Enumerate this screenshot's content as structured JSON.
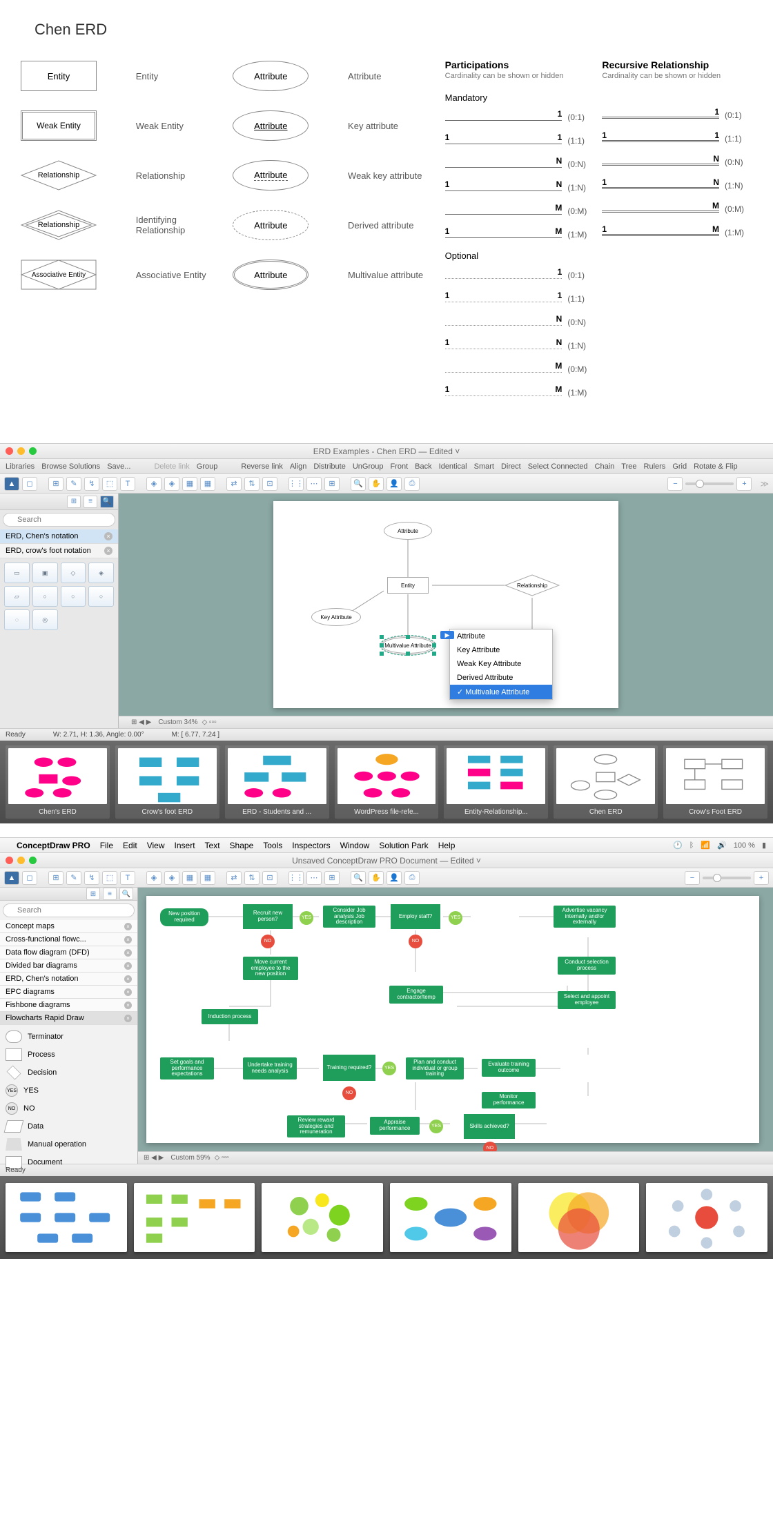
{
  "ref": {
    "title": "Chen ERD",
    "shapes_col1": [
      {
        "shape": "rect",
        "text": "Entity",
        "label": "Entity"
      },
      {
        "shape": "weak",
        "text": "Weak Entity",
        "label": "Weak Entity"
      },
      {
        "shape": "diamond",
        "text": "Relationship",
        "label": "Relationship"
      },
      {
        "shape": "diamond2",
        "text": "Relationship",
        "label": "Identifying Relationship"
      },
      {
        "shape": "assoc",
        "text": "Associative Entity",
        "label": "Associative Entity"
      }
    ],
    "shapes_col2": [
      {
        "shape": "oval",
        "text": "Attribute",
        "label": "Attribute"
      },
      {
        "shape": "oval-u",
        "text": "Attribute",
        "label": "Key attribute"
      },
      {
        "shape": "oval-du",
        "text": "Attribute",
        "label": "Weak key attribute"
      },
      {
        "shape": "oval-dash",
        "text": "Attribute",
        "label": "Derived attribute"
      },
      {
        "shape": "oval-dbl",
        "text": "Attribute",
        "label": "Multivalue attribute"
      }
    ],
    "participations": {
      "head": "Participations",
      "sub": "Cardinality can be shown or hidden",
      "mandatory_label": "Mandatory",
      "optional_label": "Optional",
      "mandatory": [
        {
          "l": "",
          "r": "1",
          "c": "(0:1)"
        },
        {
          "l": "1",
          "r": "1",
          "c": "(1:1)"
        },
        {
          "l": "",
          "r": "N",
          "c": "(0:N)"
        },
        {
          "l": "1",
          "r": "N",
          "c": "(1:N)"
        },
        {
          "l": "",
          "r": "M",
          "c": "(0:M)"
        },
        {
          "l": "1",
          "r": "M",
          "c": "(1:M)"
        }
      ],
      "optional": [
        {
          "l": "",
          "r": "1",
          "c": "(0:1)"
        },
        {
          "l": "1",
          "r": "1",
          "c": "(1:1)"
        },
        {
          "l": "",
          "r": "N",
          "c": "(0:N)"
        },
        {
          "l": "1",
          "r": "N",
          "c": "(1:N)"
        },
        {
          "l": "",
          "r": "M",
          "c": "(0:M)"
        },
        {
          "l": "1",
          "r": "M",
          "c": "(1:M)"
        }
      ]
    },
    "recursive": {
      "head": "Recursive Relationship",
      "sub": "Cardinality can be shown or hidden",
      "rows": [
        {
          "l": "",
          "r": "1",
          "c": "(0:1)"
        },
        {
          "l": "1",
          "r": "1",
          "c": "(1:1)"
        },
        {
          "l": "",
          "r": "N",
          "c": "(0:N)"
        },
        {
          "l": "1",
          "r": "N",
          "c": "(1:N)"
        },
        {
          "l": "",
          "r": "M",
          "c": "(0:M)"
        },
        {
          "l": "1",
          "r": "M",
          "c": "(1:M)"
        }
      ]
    }
  },
  "app1": {
    "title": "ERD Examples - Chen ERD — Edited ˅",
    "toolbar": [
      "Libraries",
      "Browse Solutions",
      "Save...",
      "Delete link",
      "Group",
      "Reverse link",
      "Align",
      "Distribute",
      "UnGroup",
      "Front",
      "Back",
      "Identical",
      "Smart",
      "Direct",
      "Select Connected",
      "Chain",
      "Tree",
      "Rulers",
      "Grid",
      "Rotate & Flip"
    ],
    "search_placeholder": "Search",
    "libs": [
      {
        "name": "ERD, Chen's notation",
        "sel": true
      },
      {
        "name": "ERD, crow's foot notation",
        "sel": false
      }
    ],
    "canvas_labels": {
      "attribute": "Attribute",
      "entity": "Entity",
      "key_attr": "Key Attribute",
      "relationship": "Relationship",
      "multivalue": "Multivalue Attribute"
    },
    "context_menu": [
      "Attribute",
      "Key Attribute",
      "Weak Key Attribute",
      "Derived Attribute",
      "Multivalue Attribute"
    ],
    "context_selected": "Multivalue Attribute",
    "status_zoom": "Custom 34%",
    "status_whangle": "W: 2.71,  H: 1.36,  Angle: 0.00°",
    "status_m": "M: [ 6.77, 7.24 ]",
    "ready": "Ready",
    "thumbs": [
      "Chen's ERD",
      "Crow's foot ERD",
      "ERD - Students and ...",
      "WordPress file-refe...",
      "Entity-Relationship...",
      "Chen ERD",
      "Crow's Foot ERD"
    ]
  },
  "app2": {
    "menubar_app": "ConceptDraw PRO",
    "menubar": [
      "File",
      "Edit",
      "View",
      "Insert",
      "Text",
      "Shape",
      "Tools",
      "Inspectors",
      "Window",
      "Solution Park",
      "Help"
    ],
    "menubar_right": "100 %",
    "title": "Unsaved ConceptDraw PRO Document — Edited ˅",
    "search_placeholder": "Search",
    "libs": [
      "Concept maps",
      "Cross-functional flowc...",
      "Data flow diagram (DFD)",
      "Divided bar diagrams",
      "ERD, Chen's notation",
      "EPC diagrams",
      "Fishbone diagrams",
      "Flowcharts Rapid Draw"
    ],
    "lib_selected": "Flowcharts Rapid Draw",
    "shapes": [
      "Terminator",
      "Process",
      "Decision",
      "YES",
      "NO",
      "Data",
      "Manual operation",
      "Document"
    ],
    "flow_nodes": {
      "new_position": "New position required",
      "recruit": "Recruit new person?",
      "consider": "Consider Job analysis Job description",
      "employ": "Employ staff?",
      "advertise": "Advertise vacancy internally and/or externally",
      "move": "Move current employee to the new position",
      "conduct_sel": "Conduct selection process",
      "engage": "Engage contractor/temp",
      "select_appoint": "Select and appoint employee",
      "induction": "Induction process",
      "set_goals": "Set goals and performance expectations",
      "undertake": "Undertake training needs analysis",
      "training_req": "Training required?",
      "plan_conduct": "Plan and conduct individual or group training",
      "evaluate": "Evaluate training outcome",
      "monitor": "Monitor performance",
      "review": "Review reward strategies and remuneration",
      "appraise": "Appraise performance",
      "skills": "Skills achieved?",
      "yes": "YES",
      "no": "NO"
    },
    "status_zoom": "Custom 59%",
    "ready": "Ready"
  }
}
